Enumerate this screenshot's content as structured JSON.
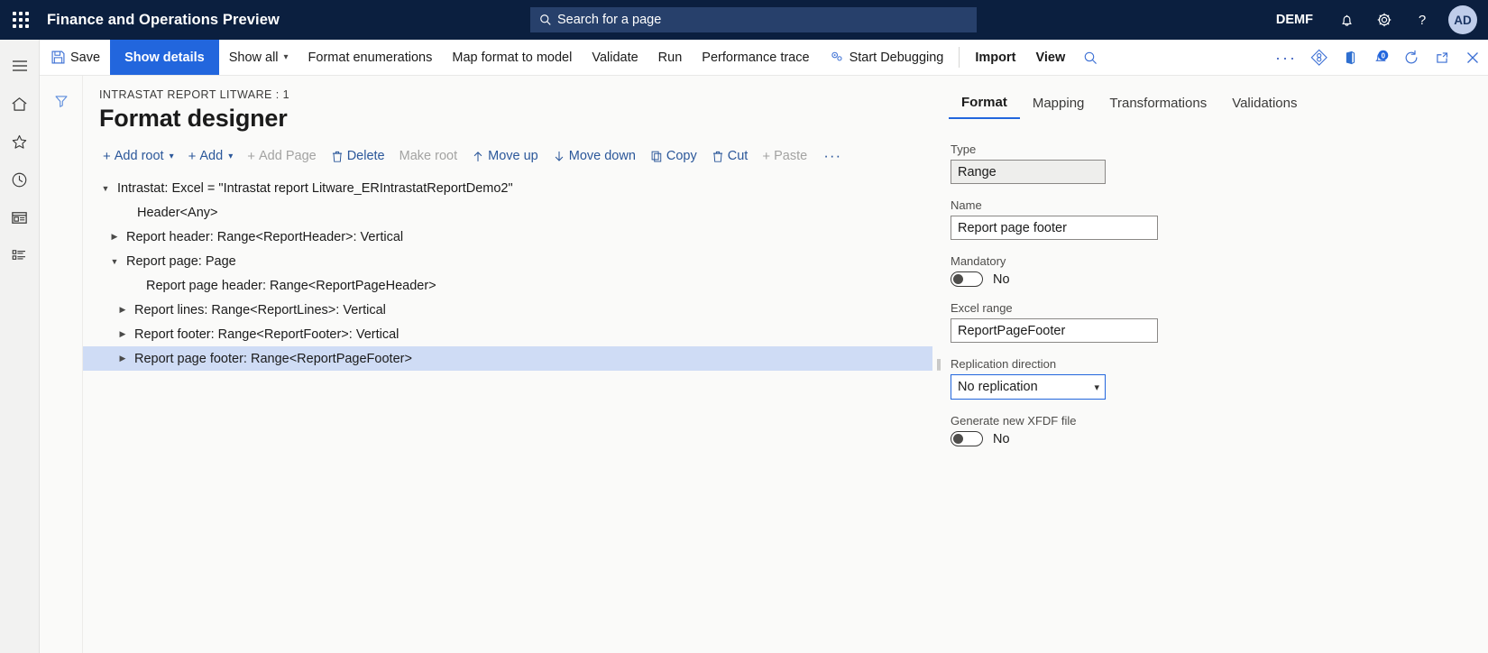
{
  "topbar": {
    "waffle_label": "app-launcher",
    "app_title": "Finance and Operations Preview",
    "search_placeholder": "Search for a page",
    "company": "DEMF",
    "notifications_icon": "bell-icon",
    "settings_icon": "gear-icon",
    "help_icon": "question-icon",
    "avatar_initials": "AD"
  },
  "rail": {
    "items": [
      {
        "icon": "hamburger-menu-icon",
        "name": "navigation-menu"
      },
      {
        "icon": "home-icon",
        "name": "home"
      },
      {
        "icon": "star-icon",
        "name": "favorites"
      },
      {
        "icon": "clock-icon",
        "name": "recent"
      },
      {
        "icon": "workspace-icon",
        "name": "workspaces"
      },
      {
        "icon": "list-icon",
        "name": "modules"
      }
    ]
  },
  "commandbar": {
    "save": "Save",
    "show_details": "Show details",
    "show_all": "Show all",
    "format_enumerations": "Format enumerations",
    "map_format_to_model": "Map format to model",
    "validate": "Validate",
    "run": "Run",
    "performance_trace": "Performance trace",
    "start_debugging": "Start Debugging",
    "import": "Import",
    "view": "View",
    "icons": {
      "search": "search-icon",
      "overflow": "ellipsis-icon",
      "attach": "attach-diamond-icon",
      "office": "office-app-icon",
      "notifications": "notification-badge-icon",
      "notifications_count": "0",
      "refresh": "refresh-icon",
      "popout": "open-in-new-window-icon",
      "close": "close-icon"
    }
  },
  "page": {
    "breadcrumb": "INTRASTAT REPORT LITWARE : 1",
    "title": "Format designer",
    "filter_icon": "filter-icon"
  },
  "actionbar": {
    "items": [
      {
        "label": "Add root",
        "glyph": "+",
        "chevron": true,
        "disabled": false,
        "name": "add-root-button"
      },
      {
        "label": "Add",
        "glyph": "+",
        "chevron": true,
        "disabled": false,
        "name": "add-button"
      },
      {
        "label": "Add Page",
        "glyph": "+",
        "chevron": false,
        "disabled": true,
        "name": "add-page-button"
      },
      {
        "label": "Delete",
        "glyph": "trash",
        "chevron": false,
        "disabled": false,
        "name": "delete-button"
      },
      {
        "label": "Make root",
        "glyph": "",
        "chevron": false,
        "disabled": true,
        "name": "make-root-button"
      },
      {
        "label": "Move up",
        "glyph": "arrow-up",
        "chevron": false,
        "disabled": false,
        "name": "move-up-button"
      },
      {
        "label": "Move down",
        "glyph": "arrow-down",
        "chevron": false,
        "disabled": false,
        "name": "move-down-button"
      },
      {
        "label": "Copy",
        "glyph": "copy",
        "chevron": false,
        "disabled": false,
        "name": "copy-button"
      },
      {
        "label": "Cut",
        "glyph": "trash",
        "chevron": false,
        "disabled": false,
        "name": "cut-button"
      },
      {
        "label": "Paste",
        "glyph": "+",
        "chevron": false,
        "disabled": true,
        "name": "paste-button"
      }
    ],
    "more": "···"
  },
  "tree": {
    "rows": [
      {
        "label": "Intrastat: Excel = \"Intrastat report Litware_ERIntrastatReportDemo2\"",
        "indent": 0,
        "twist": "expanded",
        "selected": false
      },
      {
        "label": "Header<Any>",
        "indent": 1,
        "twist": "none",
        "selected": false
      },
      {
        "label": "Report header: Range<ReportHeader>: Vertical",
        "indent": 1,
        "twist": "collapsed",
        "selected": false
      },
      {
        "label": "Report page: Page",
        "indent": 1,
        "twist": "expanded",
        "selected": false
      },
      {
        "label": "Report page header: Range<ReportPageHeader>",
        "indent": 2,
        "twist": "none",
        "selected": false
      },
      {
        "label": "Report lines: Range<ReportLines>: Vertical",
        "indent": 2,
        "twist": "collapsed",
        "selected": false
      },
      {
        "label": "Report footer: Range<ReportFooter>: Vertical",
        "indent": 2,
        "twist": "collapsed",
        "selected": false
      },
      {
        "label": "Report page footer: Range<ReportPageFooter>",
        "indent": 2,
        "twist": "collapsed",
        "selected": true
      }
    ]
  },
  "panel": {
    "tabs": [
      {
        "label": "Format",
        "active": true
      },
      {
        "label": "Mapping",
        "active": false
      },
      {
        "label": "Transformations",
        "active": false
      },
      {
        "label": "Validations",
        "active": false
      }
    ],
    "type_label": "Type",
    "type_value": "Range",
    "name_label": "Name",
    "name_value": "Report page footer",
    "mandatory_label": "Mandatory",
    "mandatory_value": "No",
    "excel_range_label": "Excel range",
    "excel_range_value": "ReportPageFooter",
    "replication_label": "Replication direction",
    "replication_value": "No replication",
    "xfdf_label": "Generate new XFDF file",
    "xfdf_value": "No"
  },
  "colors": {
    "navbar": "#0b1f3f",
    "accent": "#2266dd",
    "link": "#2b579a",
    "selection": "#cfdcf5",
    "canvas": "#fafaf9"
  }
}
